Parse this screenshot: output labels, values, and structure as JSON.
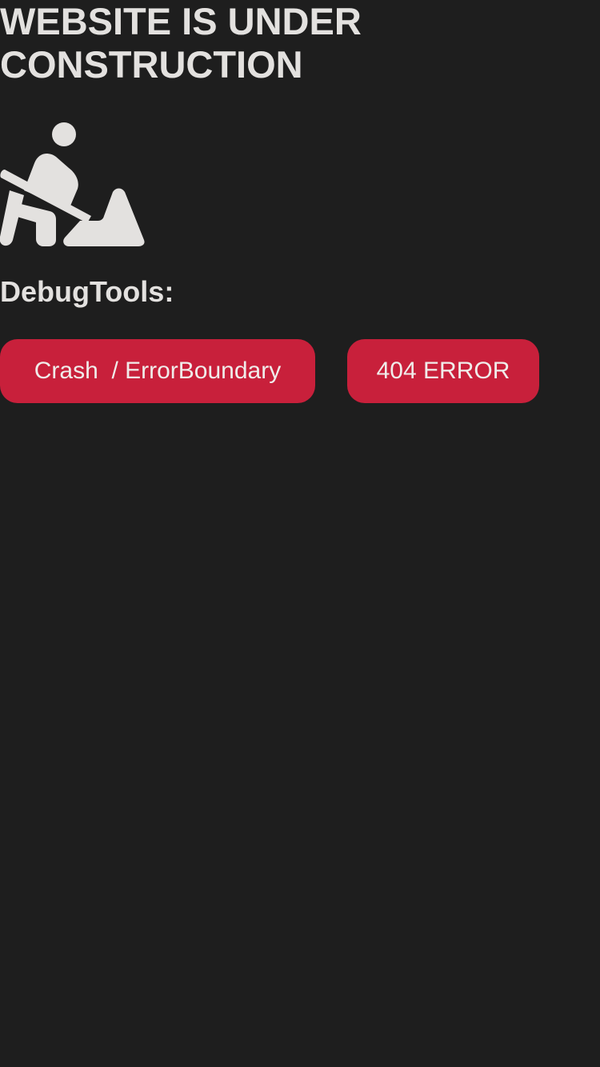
{
  "header": {
    "title": "WEBSITE IS UNDER CONSTRUCTION"
  },
  "illustration": {
    "icon": "person-digging-icon",
    "color": "#e3e1df"
  },
  "debug": {
    "heading": "DebugTools:",
    "buttons": [
      {
        "label": "Crash  / ErrorBoundary"
      },
      {
        "label": "404 ERROR"
      }
    ]
  },
  "colors": {
    "background": "#1e1e1e",
    "text": "#e3e1df",
    "button": "#c8203b",
    "button_text": "#f0ecea"
  }
}
